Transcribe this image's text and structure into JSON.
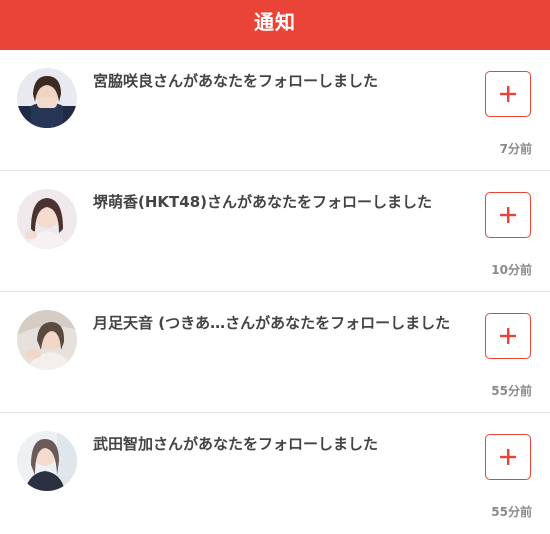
{
  "header": {
    "title": "通知"
  },
  "accent_color": "#e94437",
  "notifications": [
    {
      "message": "宮脇咲良さんがあなたをフォローしました",
      "time": "7分前",
      "avatar_icon": "user-photo-icon",
      "button_icon": "plus-icon"
    },
    {
      "message": "堺萌香(HKT48)さんがあなたをフォローしました",
      "time": "10分前",
      "avatar_icon": "user-photo-icon",
      "button_icon": "plus-icon"
    },
    {
      "message": "月足天音 (つきあ…さんがあなたをフォローしました",
      "time": "55分前",
      "avatar_icon": "user-photo-icon",
      "button_icon": "plus-icon"
    },
    {
      "message": "武田智加さんがあなたをフォローしました",
      "time": "55分前",
      "avatar_icon": "user-photo-icon",
      "button_icon": "plus-icon"
    }
  ]
}
